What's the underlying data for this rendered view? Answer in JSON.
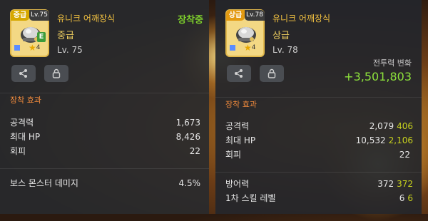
{
  "left": {
    "item": {
      "grade_tag": "중급",
      "level_tag": "Lv.75",
      "star_count": "4",
      "title": "유니크 어깨장식",
      "grade": "중급",
      "level": "Lv. 75",
      "status": "장착중"
    },
    "section_title": "장착 효과",
    "stats": [
      {
        "label": "공격력",
        "value": "1,673"
      },
      {
        "label": "최대 HP",
        "value": "8,426"
      },
      {
        "label": "회피",
        "value": "22"
      }
    ],
    "extra_stats": [
      {
        "label": "보스 몬스터 데미지",
        "value": "4.5%"
      }
    ]
  },
  "right": {
    "item": {
      "grade_tag": "상급",
      "level_tag": "Lv.78",
      "star_count": "4",
      "title": "유니크 어깨장식",
      "grade": "상급",
      "level": "Lv. 78"
    },
    "power_label": "전투력 변화",
    "power_value": "+3,501,803",
    "section_title": "장착 효과",
    "stats": [
      {
        "label": "공격력",
        "value": "2,079",
        "bonus": "406"
      },
      {
        "label": "최대 HP",
        "value": "10,532",
        "bonus": "2,106"
      },
      {
        "label": "회피",
        "value": "22",
        "bonus": ""
      }
    ],
    "extra_stats": [
      {
        "label": "방어력",
        "value": "372",
        "bonus": "372"
      },
      {
        "label": "1차 스킬 레벨",
        "value": "6",
        "bonus": "6"
      }
    ]
  },
  "icons": {
    "share": "share-icon",
    "lock": "lock-icon",
    "helmet": "helmet-icon",
    "star": "star-icon"
  },
  "colors": {
    "item_title": "#f0c040",
    "equipped": "#7ecf2c",
    "section_title": "#f08a3c",
    "power_value": "#8de23b",
    "bonus": "#c8d21e"
  }
}
